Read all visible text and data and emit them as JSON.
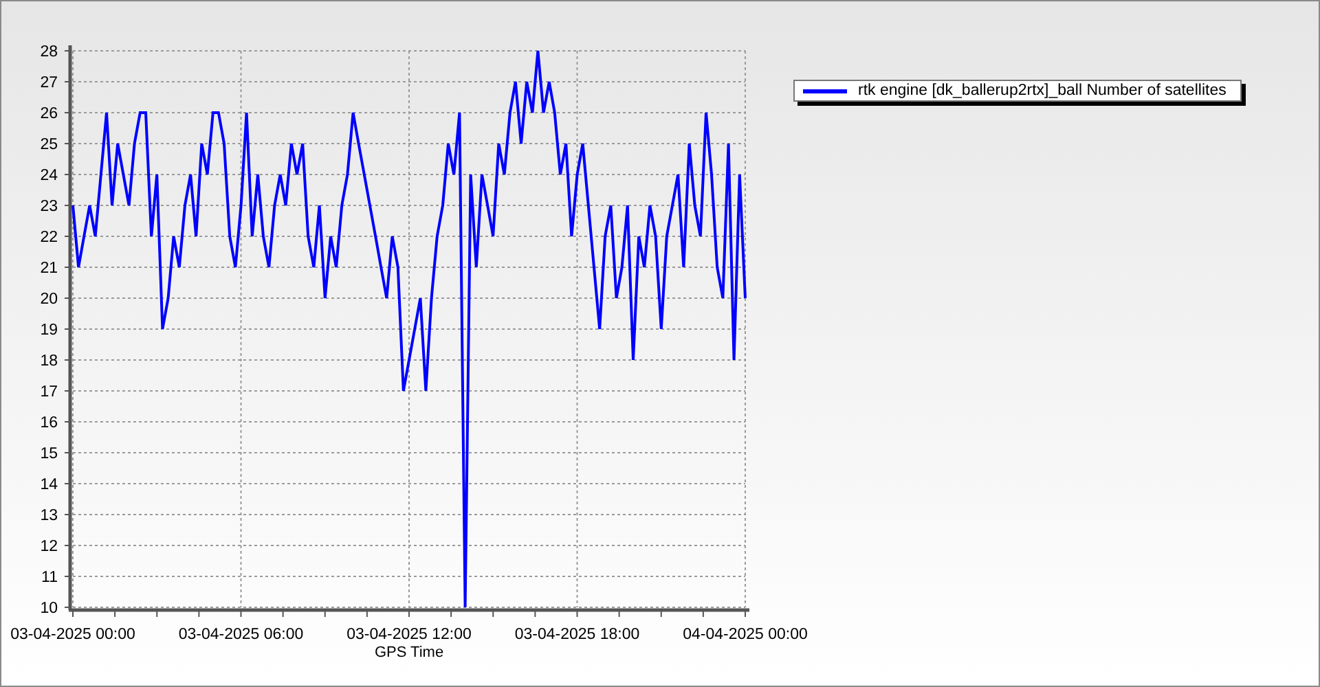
{
  "chart": {
    "chart_data": {
      "type": "line",
      "grid": true,
      "xlabel": "GPS Time",
      "ylim": [
        10,
        28
      ],
      "yticks": [
        10,
        11,
        12,
        13,
        14,
        15,
        16,
        17,
        18,
        19,
        20,
        21,
        22,
        23,
        24,
        25,
        26,
        27,
        28
      ],
      "categories": [
        "03-04-2025 00:00",
        null,
        null,
        null,
        null,
        null,
        null,
        null,
        null,
        null,
        null,
        null,
        null,
        null,
        null,
        null,
        null,
        null,
        null,
        null,
        null,
        null,
        null,
        null,
        null,
        null,
        null,
        null,
        null,
        null,
        "03-04-2025 06:00",
        null,
        null,
        null,
        null,
        null,
        null,
        null,
        null,
        null,
        null,
        null,
        null,
        null,
        null,
        null,
        null,
        null,
        null,
        null,
        null,
        null,
        null,
        null,
        null,
        null,
        null,
        null,
        null,
        null,
        "03-04-2025 12:00",
        null,
        null,
        null,
        null,
        null,
        null,
        null,
        null,
        null,
        null,
        null,
        null,
        null,
        null,
        null,
        null,
        null,
        null,
        null,
        null,
        null,
        null,
        null,
        null,
        null,
        null,
        null,
        null,
        null,
        "03-04-2025 18:00",
        null,
        null,
        null,
        null,
        null,
        null,
        null,
        null,
        null,
        null,
        null,
        null,
        null,
        null,
        null,
        null,
        null,
        null,
        null,
        null,
        null,
        null,
        null,
        null,
        null,
        null,
        null,
        null,
        null,
        "04-04-2025 00:00"
      ],
      "series": [
        {
          "name": "rtk engine [dk_ballerup2rtx]_ball Number of satellites",
          "color": "#0000ff",
          "values": [
            23,
            21,
            22,
            23,
            22,
            24,
            26,
            23,
            25,
            24,
            23,
            25,
            26,
            26,
            22,
            24,
            19,
            20,
            22,
            21,
            23,
            24,
            22,
            25,
            24,
            26,
            26,
            25,
            22,
            21,
            23,
            26,
            22,
            24,
            22,
            21,
            23,
            24,
            23,
            25,
            24,
            25,
            22,
            21,
            23,
            20,
            22,
            21,
            23,
            24,
            26,
            25,
            24,
            23,
            22,
            21,
            20,
            22,
            21,
            17,
            18,
            19,
            20,
            17,
            20,
            22,
            23,
            25,
            24,
            26,
            10,
            24,
            21,
            24,
            23,
            22,
            25,
            24,
            26,
            27,
            25,
            27,
            26,
            28,
            26,
            27,
            26,
            24,
            25,
            22,
            24,
            25,
            23,
            21,
            19,
            22,
            23,
            20,
            21,
            23,
            18,
            22,
            21,
            23,
            22,
            19,
            22,
            23,
            24,
            21,
            25,
            23,
            22,
            26,
            24,
            21,
            20,
            25,
            18,
            24,
            20
          ]
        }
      ]
    }
  }
}
